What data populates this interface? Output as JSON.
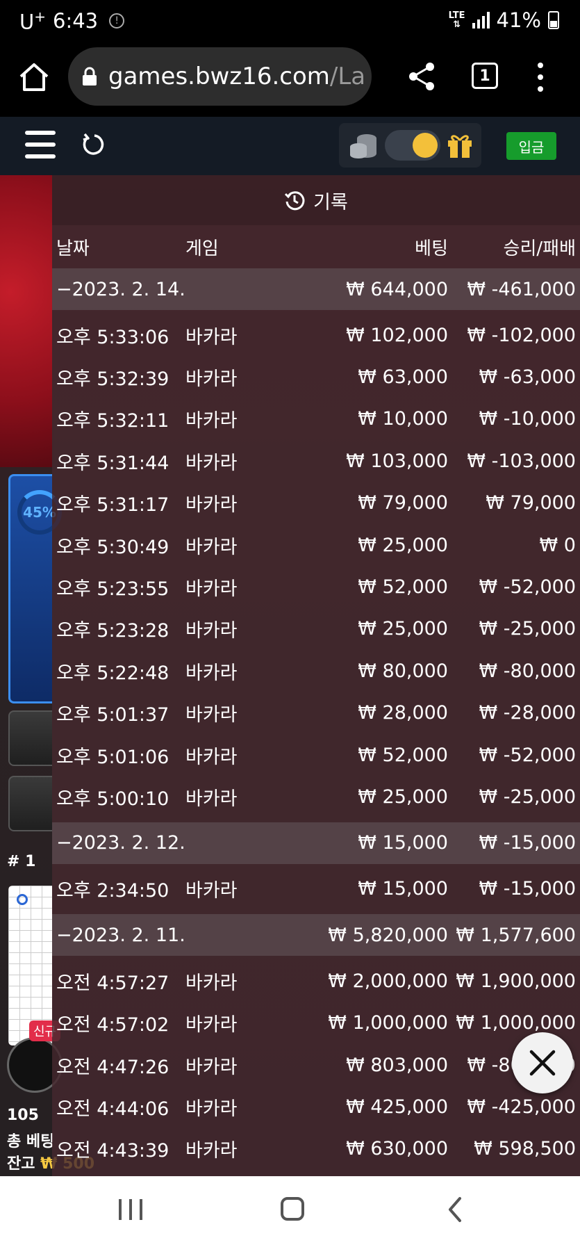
{
  "status_bar": {
    "carrier": "U",
    "carrier_sup": "+",
    "time": "6:43",
    "network": "LTE",
    "battery": "41%"
  },
  "browser": {
    "url_host": "games.bwz16.com",
    "url_path": "/La",
    "tab_count": "1"
  },
  "site_header": {
    "deposit_label": "입금",
    "toggle_on": true
  },
  "background": {
    "progress_label": "45%",
    "rank": "# 1",
    "new_badge": "신규",
    "count": "105",
    "total_bet_label": "총 베팅",
    "balance_label": "잔고",
    "balance_value": "₩ 500"
  },
  "history": {
    "title": "기록",
    "columns": {
      "date": "날짜",
      "game": "게임",
      "bet": "베팅",
      "win_loss": "승리/패배"
    },
    "groups": [
      {
        "date": "−2023. 2. 14.",
        "bet": "₩ 644,000",
        "win": "₩ -461,000",
        "rows": [
          {
            "time": "오후 5:33:06",
            "game": "바카라",
            "bet": "₩ 102,000",
            "win": "₩ -102,000"
          },
          {
            "time": "오후 5:32:39",
            "game": "바카라",
            "bet": "₩ 63,000",
            "win": "₩ -63,000"
          },
          {
            "time": "오후 5:32:11",
            "game": "바카라",
            "bet": "₩ 10,000",
            "win": "₩ -10,000"
          },
          {
            "time": "오후 5:31:44",
            "game": "바카라",
            "bet": "₩ 103,000",
            "win": "₩ -103,000"
          },
          {
            "time": "오후 5:31:17",
            "game": "바카라",
            "bet": "₩ 79,000",
            "win": "₩ 79,000"
          },
          {
            "time": "오후 5:30:49",
            "game": "바카라",
            "bet": "₩ 25,000",
            "win": "₩ 0"
          },
          {
            "time": "오후 5:23:55",
            "game": "바카라",
            "bet": "₩ 52,000",
            "win": "₩ -52,000"
          },
          {
            "time": "오후 5:23:28",
            "game": "바카라",
            "bet": "₩ 25,000",
            "win": "₩ -25,000"
          },
          {
            "time": "오후 5:22:48",
            "game": "바카라",
            "bet": "₩ 80,000",
            "win": "₩ -80,000"
          },
          {
            "time": "오후 5:01:37",
            "game": "바카라",
            "bet": "₩ 28,000",
            "win": "₩ -28,000"
          },
          {
            "time": "오후 5:01:06",
            "game": "바카라",
            "bet": "₩ 52,000",
            "win": "₩ -52,000"
          },
          {
            "time": "오후 5:00:10",
            "game": "바카라",
            "bet": "₩ 25,000",
            "win": "₩ -25,000"
          }
        ]
      },
      {
        "date": "−2023. 2. 12.",
        "bet": "₩ 15,000",
        "win": "₩ -15,000",
        "rows": [
          {
            "time": "오후 2:34:50",
            "game": "바카라",
            "bet": "₩ 15,000",
            "win": "₩ -15,000"
          }
        ]
      },
      {
        "date": "−2023. 2. 11.",
        "bet": "₩ 5,820,000",
        "win": "₩ 1,577,600",
        "rows": [
          {
            "time": "오전 4:57:27",
            "game": "바카라",
            "bet": "₩ 2,000,000",
            "win": "₩ 1,900,000"
          },
          {
            "time": "오전 4:57:02",
            "game": "바카라",
            "bet": "₩ 1,000,000",
            "win": "₩ 1,000,000"
          },
          {
            "time": "오전 4:47:26",
            "game": "바카라",
            "bet": "₩ 803,000",
            "win": "₩ -803,000"
          },
          {
            "time": "오전 4:44:06",
            "game": "바카라",
            "bet": "₩ 425,000",
            "win": "₩ -425,000"
          },
          {
            "time": "오전 4:43:39",
            "game": "바카라",
            "bet": "₩ 630,000",
            "win": "₩ 598,500"
          }
        ]
      }
    ]
  },
  "colors": {
    "deposit_green": "#169c2c",
    "toggle_knob": "#f3c03a",
    "panel_tint": "#46282e"
  }
}
